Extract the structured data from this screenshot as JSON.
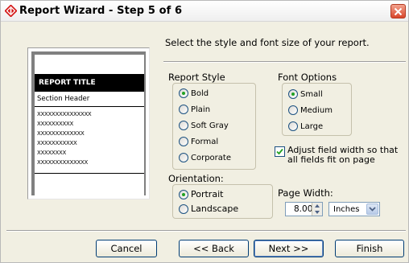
{
  "window": {
    "title": "Report Wizard - Step 5 of 6",
    "title_icon": "wizard-diamond-icon"
  },
  "preview": {
    "report_title": "REPORT TITLE",
    "section_header": "Section Header",
    "rows": [
      "XXXXXXXXXXXXXXX",
      "XXXXXXXXXX",
      "XXXXXXXXXXXXX",
      "XXXXXXXXXXX",
      "XXXXXXXX",
      "XXXXXXXXXXXXXX"
    ]
  },
  "instruction": "Select the style and font size of your report.",
  "report_style": {
    "label": "Report Style",
    "options": [
      "Bold",
      "Plain",
      "Soft Gray",
      "Formal",
      "Corporate"
    ],
    "selected": "Bold"
  },
  "font_options": {
    "label": "Font Options",
    "options": [
      "Small",
      "Medium",
      "Large"
    ],
    "selected": "Small"
  },
  "adjust_width": {
    "label": "Adjust field width so that all fields fit on page",
    "checked": true
  },
  "orientation": {
    "label": "Orientation:",
    "options": [
      "Portrait",
      "Landscape"
    ],
    "selected": "Portrait"
  },
  "page_width": {
    "label": "Page Width:",
    "value": "8.00",
    "unit": "Inches"
  },
  "buttons": {
    "cancel": "Cancel",
    "back": "<< Back",
    "next": "Next >>",
    "finish": "Finish"
  },
  "colors": {
    "face": "#f1efe2",
    "radio_dot": "#21a121",
    "checkmark": "#21a121",
    "close": "#d8462b"
  }
}
